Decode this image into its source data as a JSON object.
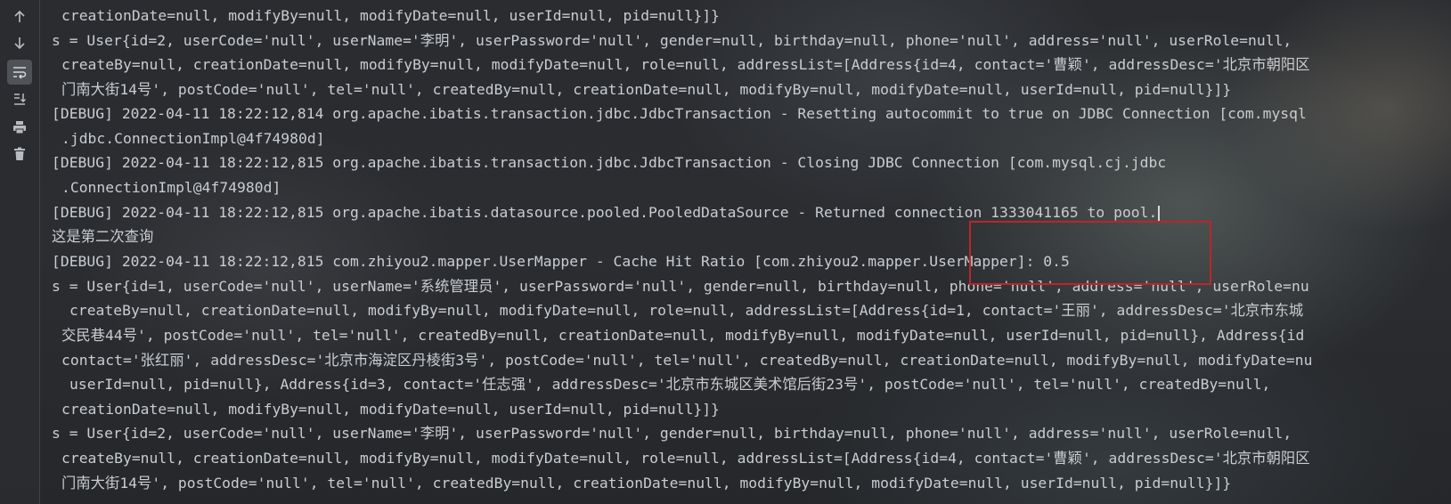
{
  "toolbar": {
    "buttons": [
      {
        "name": "scroll-up-icon"
      },
      {
        "name": "scroll-down-icon"
      },
      {
        "name": "soft-wrap-icon"
      },
      {
        "name": "scroll-to-end-icon"
      },
      {
        "name": "print-icon"
      },
      {
        "name": "clear-all-icon"
      }
    ]
  },
  "console": {
    "lines": [
      "creationDate=null, modifyBy=null, modifyDate=null, userId=null, pid=null}]}",
      "s = User{id=2, userCode='null', userName='李明', userPassword='null', gender=null, birthday=null, phone='null', address='null', userRole=null,",
      "createBy=null, creationDate=null, modifyBy=null, modifyDate=null, role=null, addressList=[Address{id=4, contact='曹颖', addressDesc='北京市朝阳区",
      "门南大街14号', postCode='null', tel='null', createdBy=null, creationDate=null, modifyBy=null, modifyDate=null, userId=null, pid=null}]}",
      "[DEBUG] 2022-04-11 18:22:12,814 org.apache.ibatis.transaction.jdbc.JdbcTransaction - Resetting autocommit to true on JDBC Connection [com.mysql",
      ".jdbc.ConnectionImpl@4f74980d]",
      "[DEBUG] 2022-04-11 18:22:12,815 org.apache.ibatis.transaction.jdbc.JdbcTransaction - Closing JDBC Connection [com.mysql.cj.jdbc",
      ".ConnectionImpl@4f74980d]",
      "[DEBUG] 2022-04-11 18:22:12,815 org.apache.ibatis.datasource.pooled.PooledDataSource - Returned connection 1333041165 to pool.",
      "这是第二次查询",
      "[DEBUG] 2022-04-11 18:22:12,815 com.zhiyou2.mapper.UserMapper - Cache Hit Ratio [com.zhiyou2.mapper.UserMapper]: 0.5",
      "s = User{id=1, userCode='null', userName='系统管理员', userPassword='null', gender=null, birthday=null, phone='null', address='null', userRole=nu",
      "createBy=null, creationDate=null, modifyBy=null, modifyDate=null, role=null, addressList=[Address{id=1, contact='王丽', addressDesc='北京市东城",
      "交民巷44号', postCode='null', tel='null', createdBy=null, creationDate=null, modifyBy=null, modifyDate=null, userId=null, pid=null}, Address{id",
      "contact='张红丽', addressDesc='北京市海淀区丹棱街3号', postCode='null', tel='null', createdBy=null, creationDate=null, modifyBy=null, modifyDate=nu",
      "userId=null, pid=null}, Address{id=3, contact='任志强', addressDesc='北京市东城区美术馆后街23号', postCode='null', tel='null', createdBy=null,",
      "creationDate=null, modifyBy=null, modifyDate=null, userId=null, pid=null}]}",
      "s = User{id=2, userCode='null', userName='李明', userPassword='null', gender=null, birthday=null, phone='null', address='null', userRole=null,",
      "createBy=null, creationDate=null, modifyBy=null, modifyDate=null, role=null, addressList=[Address{id=4, contact='曹颖', addressDesc='北京市朝阳区",
      "门南大街14号', postCode='null', tel='null', createdBy=null, creationDate=null, modifyBy=null, modifyDate=null, userId=null, pid=null}]}"
    ]
  },
  "colors": {
    "text": "#c9cdd1",
    "highlight_box": "#b9262b",
    "toolbar_bg": "#2b2d30"
  }
}
